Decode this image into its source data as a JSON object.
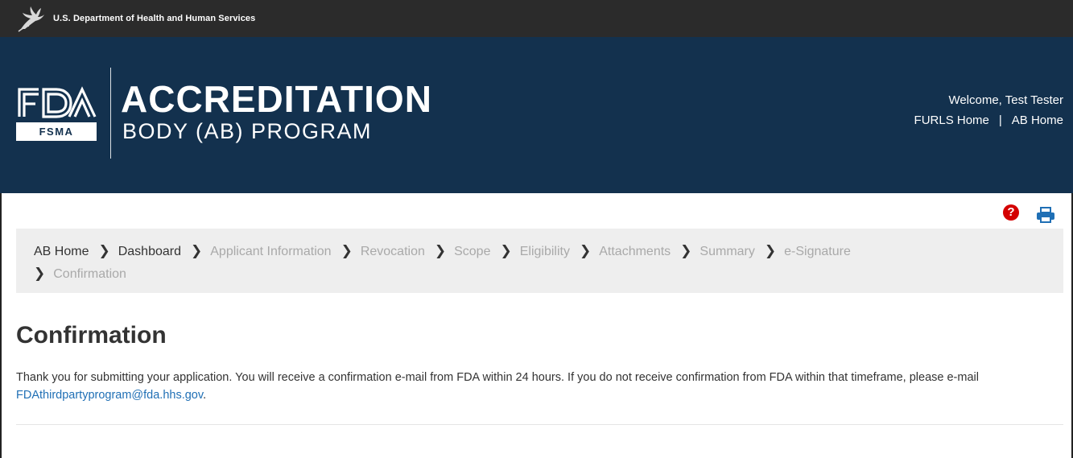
{
  "hhs_bar": {
    "agency_name": "U.S. Department of Health and Human Services",
    "logo_icon": "hhs-eagle-icon"
  },
  "banner": {
    "fda_logo_text": "FDA",
    "fsma_label": "FSMA",
    "title_line1": "ACCREDITATION",
    "title_line2": "BODY (AB) PROGRAM",
    "welcome_text": "Welcome, Test Tester",
    "links": {
      "furls_home": "FURLS Home",
      "separator": "|",
      "ab_home": "AB Home"
    },
    "background_color": "#13314e"
  },
  "tools": {
    "help_glyph": "?",
    "help_icon": "help-icon",
    "print_icon": "print-icon",
    "help_color": "#d40000",
    "print_color": "#1f6fb5"
  },
  "breadcrumb": {
    "items": [
      {
        "label": "AB Home",
        "state": "active"
      },
      {
        "label": "Dashboard",
        "state": "active"
      },
      {
        "label": "Applicant Information",
        "state": "inactive"
      },
      {
        "label": "Revocation",
        "state": "inactive"
      },
      {
        "label": "Scope",
        "state": "inactive"
      },
      {
        "label": "Eligibility",
        "state": "inactive"
      },
      {
        "label": "Attachments",
        "state": "inactive"
      },
      {
        "label": "Summary",
        "state": "inactive"
      },
      {
        "label": "e-Signature",
        "state": "inactive"
      },
      {
        "label": "Confirmation",
        "state": "inactive"
      }
    ],
    "separator_glyph": "❯"
  },
  "main": {
    "title": "Confirmation",
    "message_before_link": "Thank you for submitting your application. You will receive a confirmation e-mail from FDA within 24 hours. If you do not receive confirmation from FDA within that timeframe, please e-mail ",
    "email_link": "FDAthirdpartyprogram@fda.hhs.gov",
    "message_after_link": "."
  }
}
